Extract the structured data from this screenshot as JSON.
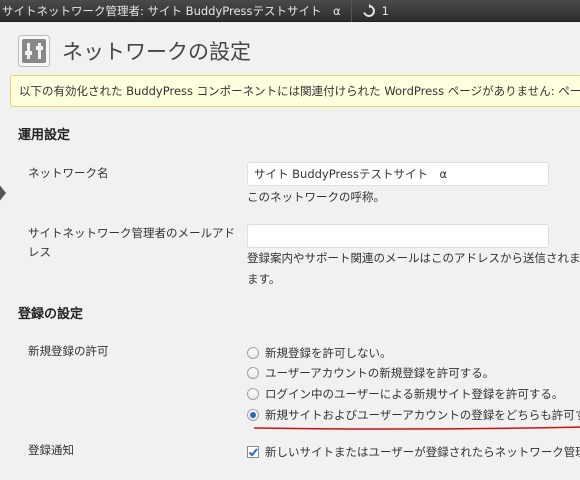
{
  "adminbar": {
    "site_title": "サイトネットワーク管理者: サイト BuddyPressテストサイト　α",
    "updates_count": "1"
  },
  "page": {
    "title": "ネットワークの設定"
  },
  "notice": {
    "text": "以下の有効化された BuddyPress コンポーネントには関連付けられた WordPress ページがありません: ページを"
  },
  "sections": {
    "operations": {
      "heading": "運用設定",
      "network_name_label": "ネットワーク名",
      "network_name_value": "サイト BuddyPressテストサイト　α",
      "network_name_desc": "このネットワークの呼称。",
      "admin_email_label_line1": "サイトネットワーク管理者のメールアド",
      "admin_email_label_line2": "レス",
      "admin_email_value": "",
      "admin_email_desc_line1": "登録案内やサポート関連のメールはこのアドレスから送信されま",
      "admin_email_desc_line2": "ます。"
    },
    "registration": {
      "heading": "登録の設定",
      "allow_label": "新規登録の許可",
      "options": [
        {
          "label": "新規登録を許可しない。",
          "checked": false
        },
        {
          "label": "ユーザーアカウントの新規登録を許可する。",
          "checked": false
        },
        {
          "label": "ログイン中のユーザーによる新規サイト登録を許可する。",
          "checked": false
        },
        {
          "label": "新規サイトおよびユーザーアカウントの登録をどちらも許可する",
          "checked": true
        }
      ],
      "notify_label": "登録通知",
      "notify_text": "新しいサイトまたはユーザーが登録されたらネットワーク管理者",
      "notify_checked": true
    }
  },
  "colors": {
    "admin_bar": "#2d2d2d",
    "notice_bg": "#ffffe0",
    "notice_border": "#e6db55",
    "radio_accent": "#2a66c4",
    "annotation_red": "#d01010"
  }
}
